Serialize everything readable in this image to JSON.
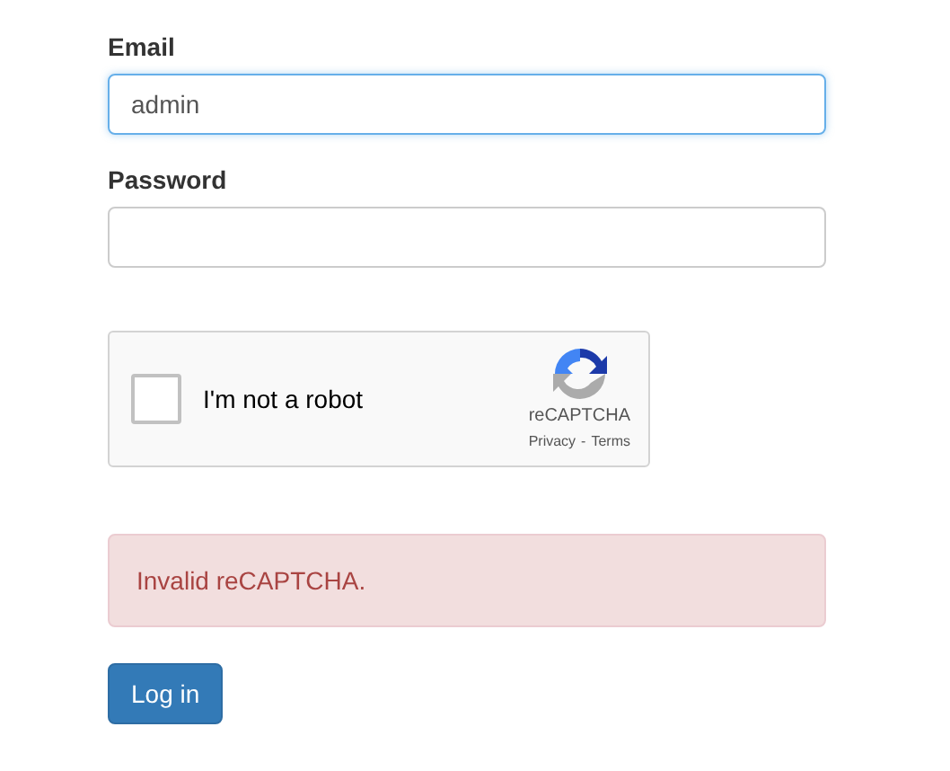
{
  "email": {
    "label": "Email",
    "value": "admin",
    "focused": true
  },
  "password": {
    "label": "Password",
    "focused": false
  },
  "captcha": {
    "label": "I'm not a robot",
    "checked": false,
    "brand": "reCAPTCHA",
    "privacy": "Privacy",
    "separator": "-",
    "terms": "Terms"
  },
  "alert": {
    "message": "Invalid reCAPTCHA."
  },
  "buttons": [
    "Log in"
  ]
}
